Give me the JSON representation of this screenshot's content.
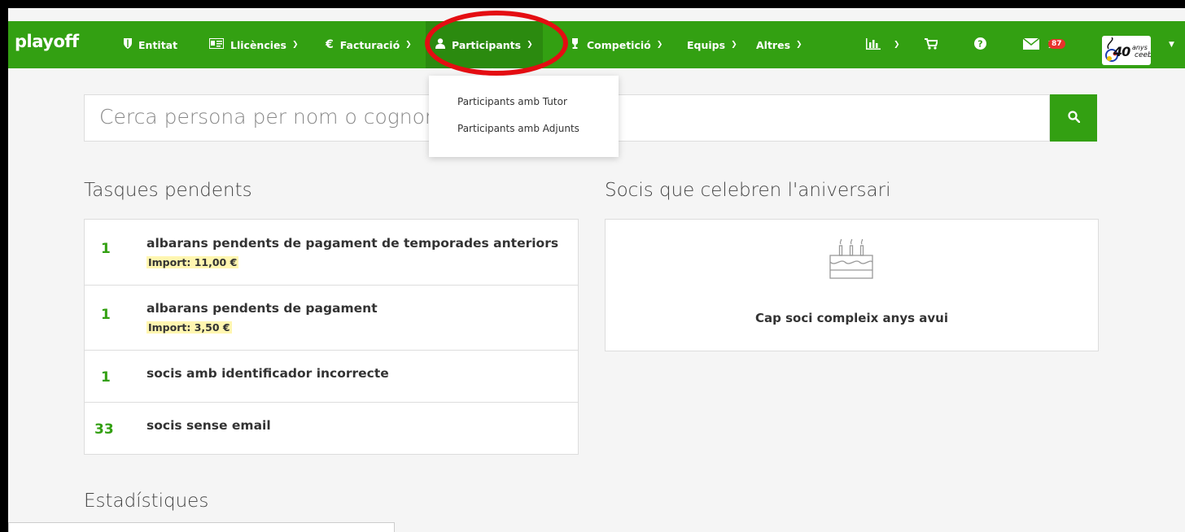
{
  "navbar": {
    "brand": "playoff",
    "items": [
      {
        "label": "Entitat",
        "icon": "shield-icon"
      },
      {
        "label": "Llicències",
        "icon": "id-card-icon"
      },
      {
        "label": "Facturació",
        "icon": "euro-icon"
      },
      {
        "label": "Participants",
        "icon": "user-icon"
      },
      {
        "label": "Competició",
        "icon": "trophy-icon"
      },
      {
        "label": "Equips"
      },
      {
        "label": "Altres"
      }
    ],
    "messages_badge": "87",
    "logo_text": "40",
    "logo_sub": "anys",
    "logo_sub2": "ceeb",
    "colors": {
      "navbar": "#33a012",
      "highlight": "#e40d12"
    }
  },
  "participants_menu": {
    "items": [
      "Participants amb Tutor",
      "Participants amb Adjunts"
    ]
  },
  "search": {
    "placeholder": "Cerca persona per nom o cognom"
  },
  "tasks": {
    "title": "Tasques pendents",
    "items": [
      {
        "count": "1",
        "label": "albarans pendents de pagament de temporades anteriors",
        "import": "Import: 11,00 €"
      },
      {
        "count": "1",
        "label": "albarans pendents de pagament",
        "import": "Import: 3,50 €"
      },
      {
        "count": "1",
        "label": "socis amb identificador incorrecte"
      },
      {
        "count": "33",
        "label": "socis sense email"
      }
    ]
  },
  "birthdays": {
    "title": "Socis que celebren l'aniversari",
    "empty": "Cap soci compleix anys avui"
  },
  "stats": {
    "title": "Estadístiques"
  }
}
